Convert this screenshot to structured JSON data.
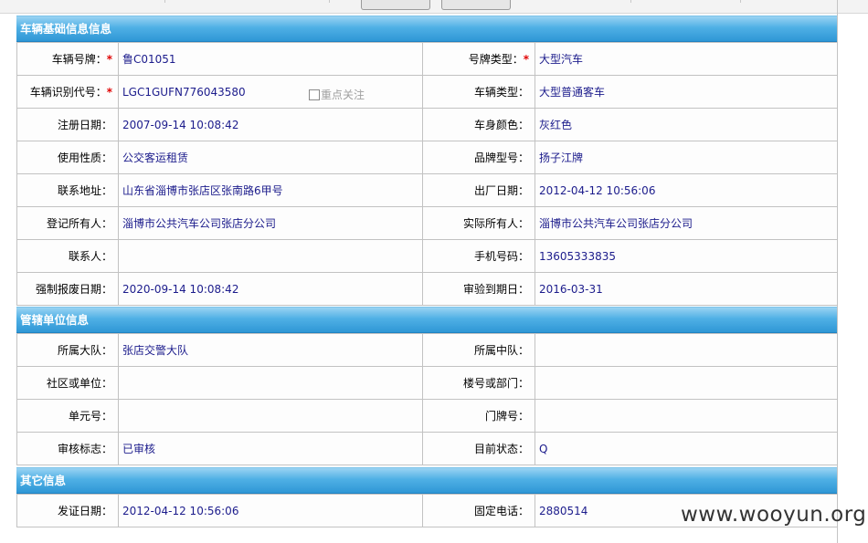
{
  "vehicle_basic": {
    "title": "车辆基础信息信息",
    "rows": [
      [
        {
          "label": "车辆号牌：",
          "required": true,
          "value": "鲁C01051"
        },
        {
          "label": "号牌类型：",
          "required": true,
          "value": "大型汽车"
        }
      ],
      [
        {
          "label": "车辆识别代号：",
          "required": true,
          "value": "LGC1GUFN776043580",
          "extra": "重点关注"
        },
        {
          "label": "车辆类型：",
          "required": false,
          "value": "大型普通客车"
        }
      ],
      [
        {
          "label": "注册日期：",
          "required": false,
          "value": "2007-09-14 10:08:42"
        },
        {
          "label": "车身颜色：",
          "required": false,
          "value": "灰红色"
        }
      ],
      [
        {
          "label": "使用性质：",
          "required": false,
          "value": "公交客运租赁"
        },
        {
          "label": "品牌型号：",
          "required": false,
          "value": "扬子江牌"
        }
      ],
      [
        {
          "label": "联系地址：",
          "required": false,
          "value": "山东省淄博市张店区张南路6甲号"
        },
        {
          "label": "出厂日期：",
          "required": false,
          "value": "2012-04-12 10:56:06"
        }
      ],
      [
        {
          "label": "登记所有人：",
          "required": false,
          "value": "淄博市公共汽车公司张店分公司"
        },
        {
          "label": "实际所有人：",
          "required": false,
          "value": "淄博市公共汽车公司张店分公司"
        }
      ],
      [
        {
          "label": "联系人：",
          "required": false,
          "value": ""
        },
        {
          "label": "手机号码：",
          "required": false,
          "value": "13605333835"
        }
      ],
      [
        {
          "label": "强制报废日期：",
          "required": false,
          "value": "2020-09-14 10:08:42"
        },
        {
          "label": "审验到期日：",
          "required": false,
          "value": "2016-03-31"
        }
      ]
    ]
  },
  "management_unit": {
    "title": "管辖单位信息",
    "rows": [
      [
        {
          "label": "所属大队：",
          "value": "张店交警大队"
        },
        {
          "label": "所属中队：",
          "value": ""
        }
      ],
      [
        {
          "label": "社区或单位：",
          "value": ""
        },
        {
          "label": "楼号或部门：",
          "value": ""
        }
      ],
      [
        {
          "label": "单元号：",
          "value": ""
        },
        {
          "label": "门牌号：",
          "value": ""
        }
      ],
      [
        {
          "label": "审核标志：",
          "value": "已审核"
        },
        {
          "label": "目前状态：",
          "value": "Q"
        }
      ]
    ]
  },
  "other_info": {
    "title": "其它信息",
    "rows": [
      [
        {
          "label": "发证日期：",
          "value": "2012-04-12 10:56:06"
        },
        {
          "label": "固定电话：",
          "value": "2880514"
        }
      ]
    ]
  },
  "required_mark": "*",
  "watermark": "www.wooyun.org",
  "colors": {
    "header_blue": "#2f97d6",
    "value_text": "#1c1c8c",
    "required": "#e00000"
  }
}
